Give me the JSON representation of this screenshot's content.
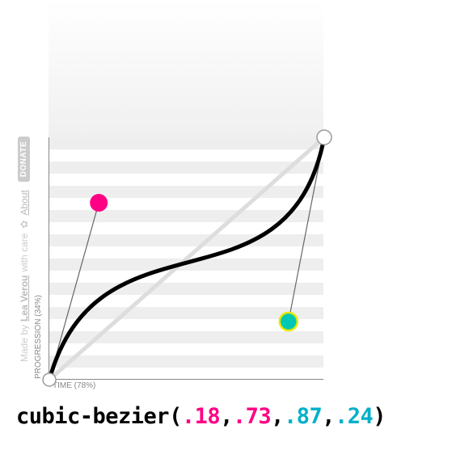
{
  "credits": {
    "prefix": "Made by",
    "author": "Lea Verou",
    "suffix": "with care",
    "about": "About",
    "donate": "DONATE"
  },
  "axes": {
    "y_label": "PROGRESSION",
    "y_pct": "(34%)",
    "x_label": "TIME",
    "x_pct": "(78%)"
  },
  "bezier": {
    "fn": "cubic-bezier",
    "p1x": ".18",
    "p1y": ".73",
    "p2x": ".87",
    "p2y": ".24"
  },
  "chart_data": {
    "type": "line",
    "title": "cubic-bezier(.18,.73,.87,.24)",
    "xlabel": "TIME",
    "ylabel": "PROGRESSION",
    "xlim": [
      0,
      1
    ],
    "ylim": [
      0,
      1
    ],
    "control_points": {
      "p0": [
        0,
        0
      ],
      "p1": [
        0.18,
        0.73
      ],
      "p2": [
        0.87,
        0.24
      ],
      "p3": [
        1,
        1
      ]
    },
    "axis_cursor": {
      "time_pct": 78,
      "progression_pct": 34
    }
  }
}
